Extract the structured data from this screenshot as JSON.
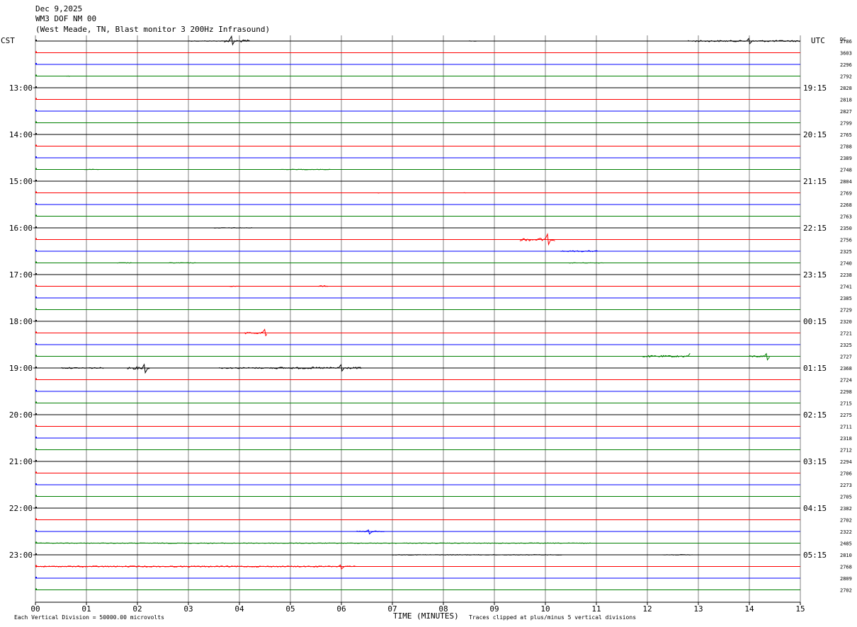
{
  "header": {
    "line1": "Dec 9,2025",
    "line2": "WM3 DOF NM 00",
    "line3": "(West Meade, TN, Blast monitor 3 200Hz Infrasound)"
  },
  "left_zone": "CST",
  "right_zone": "UTC",
  "dc_label": "DC",
  "footer": {
    "scale_note": "Each Vertical Division = 50000.00 microvolts",
    "xlabel": "TIME (MINUTES)",
    "clip_note": "Traces clipped at plus/minus 5 vertical divisions"
  },
  "colors": {
    "cycle": [
      "#000000",
      "#ff0000",
      "#0000ff",
      "#008000"
    ],
    "grid": "#808080"
  },
  "chart_data": {
    "type": "line",
    "x_ticks": [
      "00",
      "01",
      "02",
      "03",
      "04",
      "05",
      "06",
      "07",
      "08",
      "09",
      "10",
      "11",
      "12",
      "13",
      "14",
      "15"
    ],
    "xlim": [
      0,
      15
    ],
    "left_hour_labels": [
      "13:00",
      "14:00",
      "15:00",
      "16:00",
      "17:00",
      "18:00",
      "19:00",
      "20:00",
      "21:00",
      "22:00",
      "23:00"
    ],
    "right_hour_labels": [
      "19:15",
      "20:15",
      "21:15",
      "22:15",
      "23:15",
      "00:15",
      "01:15",
      "02:15",
      "03:15",
      "04:15",
      "05:15"
    ],
    "dc_values": [
      "2786",
      "3603",
      "2296",
      "2792",
      "2828",
      "2818",
      "2827",
      "2799",
      "2765",
      "2788",
      "2389",
      "2748",
      "2804",
      "2769",
      "2268",
      "2763",
      "2350",
      "2756",
      "2325",
      "2740",
      "2238",
      "2741",
      "2385",
      "2729",
      "2320",
      "2721",
      "2325",
      "2727",
      "2368",
      "2724",
      "2298",
      "2715",
      "2275",
      "2711",
      "2318",
      "2712",
      "2294",
      "2706",
      "2273",
      "2705",
      "2382",
      "2702",
      "2322",
      "2485",
      "2810",
      "2768",
      "2809",
      "2702"
    ],
    "events": [
      {
        "trace": 0,
        "start": 3.0,
        "end": 3.85,
        "amp": 1
      },
      {
        "trace": 0,
        "start": 3.7,
        "end": 4.2,
        "amp": 4,
        "spike": 3.85
      },
      {
        "trace": 0,
        "start": 8.5,
        "end": 8.65,
        "amp": 1
      },
      {
        "trace": 0,
        "start": 12.8,
        "end": 15.0,
        "amp": 2.5,
        "spike": 14.0
      },
      {
        "trace": 3,
        "start": 0.6,
        "end": 0.7,
        "amp": 1
      },
      {
        "trace": 11,
        "start": 0.95,
        "end": 1.25,
        "amp": 1
      },
      {
        "trace": 11,
        "start": 4.8,
        "end": 5.8,
        "amp": 1
      },
      {
        "trace": 13,
        "start": 6.7,
        "end": 6.75,
        "amp": 1
      },
      {
        "trace": 13,
        "start": 8.4,
        "end": 8.45,
        "amp": 1
      },
      {
        "trace": 16,
        "start": 3.5,
        "end": 4.25,
        "amp": 1
      },
      {
        "trace": 17,
        "start": 9.5,
        "end": 10.2,
        "amp": 5,
        "spike": 10.05
      },
      {
        "trace": 18,
        "start": 10.3,
        "end": 11.05,
        "amp": 2
      },
      {
        "trace": 19,
        "start": 1.6,
        "end": 1.9,
        "amp": 1
      },
      {
        "trace": 19,
        "start": 2.6,
        "end": 3.15,
        "amp": 1
      },
      {
        "trace": 19,
        "start": 10.45,
        "end": 11.15,
        "amp": 1
      },
      {
        "trace": 21,
        "start": 3.8,
        "end": 4.0,
        "amp": 1
      },
      {
        "trace": 21,
        "start": 5.55,
        "end": 5.75,
        "amp": 2
      },
      {
        "trace": 25,
        "start": 4.1,
        "end": 4.55,
        "amp": 3,
        "spike": 4.5
      },
      {
        "trace": 27,
        "start": 11.9,
        "end": 12.85,
        "amp": 3,
        "spike": 12.85
      },
      {
        "trace": 27,
        "start": 14.0,
        "end": 14.4,
        "amp": 3,
        "spike": 14.35
      },
      {
        "trace": 28,
        "start": 0.5,
        "end": 1.35,
        "amp": 2
      },
      {
        "trace": 28,
        "start": 1.8,
        "end": 2.25,
        "amp": 4,
        "spike": 2.15
      },
      {
        "trace": 28,
        "start": 3.6,
        "end": 4.75,
        "amp": 2
      },
      {
        "trace": 28,
        "start": 4.7,
        "end": 6.4,
        "amp": 3,
        "spike": 6.0
      },
      {
        "trace": 42,
        "start": 6.3,
        "end": 6.85,
        "amp": 2,
        "spike": 6.55
      },
      {
        "trace": 43,
        "start": 0.0,
        "end": 7.1,
        "amp": 1
      },
      {
        "trace": 43,
        "start": 7.2,
        "end": 10.9,
        "amp": 1
      },
      {
        "trace": 44,
        "start": 7.0,
        "end": 10.35,
        "amp": 1
      },
      {
        "trace": 44,
        "start": 12.3,
        "end": 12.9,
        "amp": 1
      },
      {
        "trace": 45,
        "start": 0.0,
        "end": 6.3,
        "amp": 2,
        "spike": 6.0
      }
    ]
  }
}
